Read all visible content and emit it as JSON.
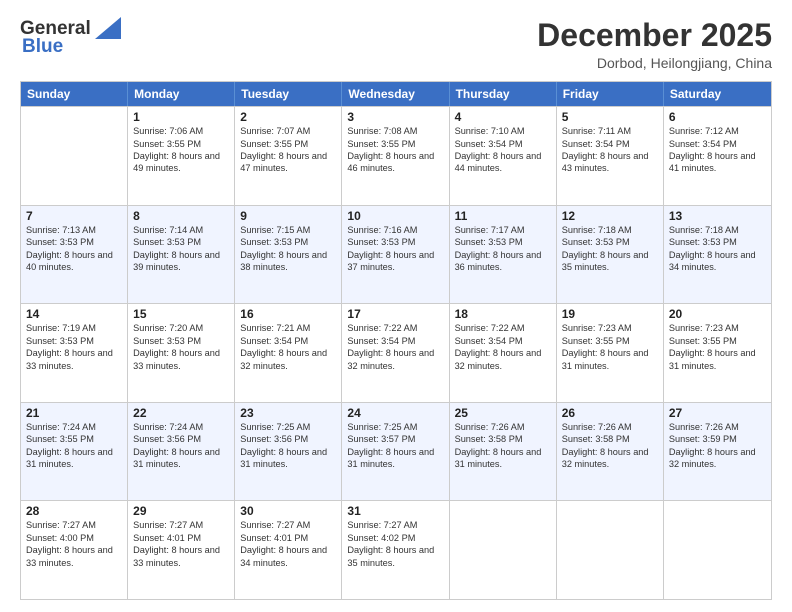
{
  "header": {
    "logo_line1": "General",
    "logo_line2": "Blue",
    "month_title": "December 2025",
    "subtitle": "Dorbod, Heilongjiang, China"
  },
  "days_of_week": [
    "Sunday",
    "Monday",
    "Tuesday",
    "Wednesday",
    "Thursday",
    "Friday",
    "Saturday"
  ],
  "weeks": [
    [
      {
        "day": "",
        "sunrise": "",
        "sunset": "",
        "daylight": ""
      },
      {
        "day": "1",
        "sunrise": "Sunrise: 7:06 AM",
        "sunset": "Sunset: 3:55 PM",
        "daylight": "Daylight: 8 hours and 49 minutes."
      },
      {
        "day": "2",
        "sunrise": "Sunrise: 7:07 AM",
        "sunset": "Sunset: 3:55 PM",
        "daylight": "Daylight: 8 hours and 47 minutes."
      },
      {
        "day": "3",
        "sunrise": "Sunrise: 7:08 AM",
        "sunset": "Sunset: 3:55 PM",
        "daylight": "Daylight: 8 hours and 46 minutes."
      },
      {
        "day": "4",
        "sunrise": "Sunrise: 7:10 AM",
        "sunset": "Sunset: 3:54 PM",
        "daylight": "Daylight: 8 hours and 44 minutes."
      },
      {
        "day": "5",
        "sunrise": "Sunrise: 7:11 AM",
        "sunset": "Sunset: 3:54 PM",
        "daylight": "Daylight: 8 hours and 43 minutes."
      },
      {
        "day": "6",
        "sunrise": "Sunrise: 7:12 AM",
        "sunset": "Sunset: 3:54 PM",
        "daylight": "Daylight: 8 hours and 41 minutes."
      }
    ],
    [
      {
        "day": "7",
        "sunrise": "Sunrise: 7:13 AM",
        "sunset": "Sunset: 3:53 PM",
        "daylight": "Daylight: 8 hours and 40 minutes."
      },
      {
        "day": "8",
        "sunrise": "Sunrise: 7:14 AM",
        "sunset": "Sunset: 3:53 PM",
        "daylight": "Daylight: 8 hours and 39 minutes."
      },
      {
        "day": "9",
        "sunrise": "Sunrise: 7:15 AM",
        "sunset": "Sunset: 3:53 PM",
        "daylight": "Daylight: 8 hours and 38 minutes."
      },
      {
        "day": "10",
        "sunrise": "Sunrise: 7:16 AM",
        "sunset": "Sunset: 3:53 PM",
        "daylight": "Daylight: 8 hours and 37 minutes."
      },
      {
        "day": "11",
        "sunrise": "Sunrise: 7:17 AM",
        "sunset": "Sunset: 3:53 PM",
        "daylight": "Daylight: 8 hours and 36 minutes."
      },
      {
        "day": "12",
        "sunrise": "Sunrise: 7:18 AM",
        "sunset": "Sunset: 3:53 PM",
        "daylight": "Daylight: 8 hours and 35 minutes."
      },
      {
        "day": "13",
        "sunrise": "Sunrise: 7:18 AM",
        "sunset": "Sunset: 3:53 PM",
        "daylight": "Daylight: 8 hours and 34 minutes."
      }
    ],
    [
      {
        "day": "14",
        "sunrise": "Sunrise: 7:19 AM",
        "sunset": "Sunset: 3:53 PM",
        "daylight": "Daylight: 8 hours and 33 minutes."
      },
      {
        "day": "15",
        "sunrise": "Sunrise: 7:20 AM",
        "sunset": "Sunset: 3:53 PM",
        "daylight": "Daylight: 8 hours and 33 minutes."
      },
      {
        "day": "16",
        "sunrise": "Sunrise: 7:21 AM",
        "sunset": "Sunset: 3:54 PM",
        "daylight": "Daylight: 8 hours and 32 minutes."
      },
      {
        "day": "17",
        "sunrise": "Sunrise: 7:22 AM",
        "sunset": "Sunset: 3:54 PM",
        "daylight": "Daylight: 8 hours and 32 minutes."
      },
      {
        "day": "18",
        "sunrise": "Sunrise: 7:22 AM",
        "sunset": "Sunset: 3:54 PM",
        "daylight": "Daylight: 8 hours and 32 minutes."
      },
      {
        "day": "19",
        "sunrise": "Sunrise: 7:23 AM",
        "sunset": "Sunset: 3:55 PM",
        "daylight": "Daylight: 8 hours and 31 minutes."
      },
      {
        "day": "20",
        "sunrise": "Sunrise: 7:23 AM",
        "sunset": "Sunset: 3:55 PM",
        "daylight": "Daylight: 8 hours and 31 minutes."
      }
    ],
    [
      {
        "day": "21",
        "sunrise": "Sunrise: 7:24 AM",
        "sunset": "Sunset: 3:55 PM",
        "daylight": "Daylight: 8 hours and 31 minutes."
      },
      {
        "day": "22",
        "sunrise": "Sunrise: 7:24 AM",
        "sunset": "Sunset: 3:56 PM",
        "daylight": "Daylight: 8 hours and 31 minutes."
      },
      {
        "day": "23",
        "sunrise": "Sunrise: 7:25 AM",
        "sunset": "Sunset: 3:56 PM",
        "daylight": "Daylight: 8 hours and 31 minutes."
      },
      {
        "day": "24",
        "sunrise": "Sunrise: 7:25 AM",
        "sunset": "Sunset: 3:57 PM",
        "daylight": "Daylight: 8 hours and 31 minutes."
      },
      {
        "day": "25",
        "sunrise": "Sunrise: 7:26 AM",
        "sunset": "Sunset: 3:58 PM",
        "daylight": "Daylight: 8 hours and 31 minutes."
      },
      {
        "day": "26",
        "sunrise": "Sunrise: 7:26 AM",
        "sunset": "Sunset: 3:58 PM",
        "daylight": "Daylight: 8 hours and 32 minutes."
      },
      {
        "day": "27",
        "sunrise": "Sunrise: 7:26 AM",
        "sunset": "Sunset: 3:59 PM",
        "daylight": "Daylight: 8 hours and 32 minutes."
      }
    ],
    [
      {
        "day": "28",
        "sunrise": "Sunrise: 7:27 AM",
        "sunset": "Sunset: 4:00 PM",
        "daylight": "Daylight: 8 hours and 33 minutes."
      },
      {
        "day": "29",
        "sunrise": "Sunrise: 7:27 AM",
        "sunset": "Sunset: 4:01 PM",
        "daylight": "Daylight: 8 hours and 33 minutes."
      },
      {
        "day": "30",
        "sunrise": "Sunrise: 7:27 AM",
        "sunset": "Sunset: 4:01 PM",
        "daylight": "Daylight: 8 hours and 34 minutes."
      },
      {
        "day": "31",
        "sunrise": "Sunrise: 7:27 AM",
        "sunset": "Sunset: 4:02 PM",
        "daylight": "Daylight: 8 hours and 35 minutes."
      },
      {
        "day": "",
        "sunrise": "",
        "sunset": "",
        "daylight": ""
      },
      {
        "day": "",
        "sunrise": "",
        "sunset": "",
        "daylight": ""
      },
      {
        "day": "",
        "sunrise": "",
        "sunset": "",
        "daylight": ""
      }
    ]
  ]
}
